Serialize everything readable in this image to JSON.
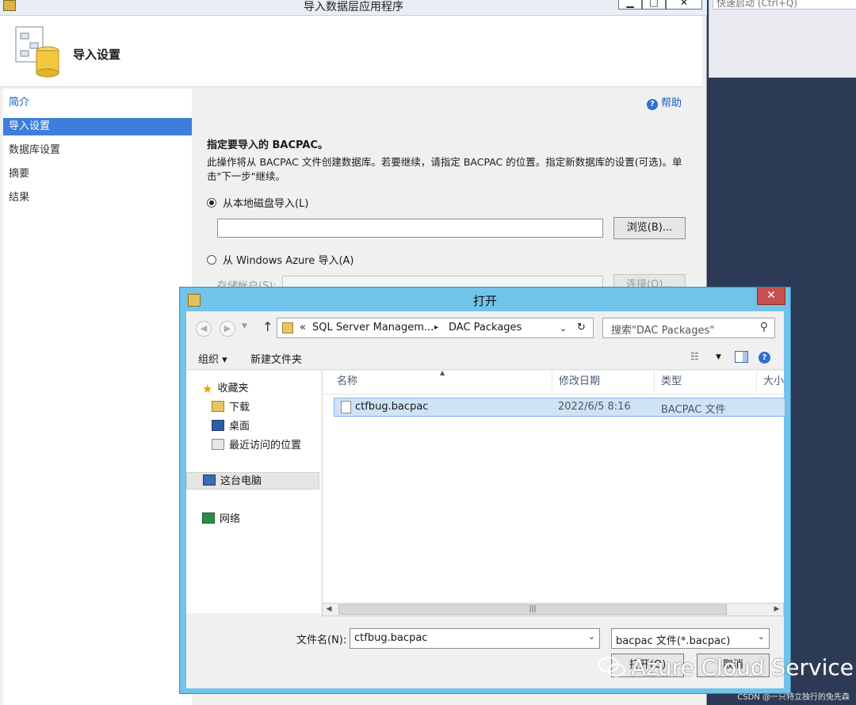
{
  "wizard": {
    "title": "导入数据层应用程序",
    "minimize": "▁",
    "maximize": "□",
    "close": "✕",
    "header_title": "导入设置",
    "nav": [
      "简介",
      "导入设置",
      "数据库设置",
      "摘要",
      "结果"
    ],
    "help": "帮助",
    "section_title": "指定要导入的 BACPAC。",
    "section_desc": "此操作将从 BACPAC 文件创建数据库。若要继续，请指定 BACPAC 的位置。指定新数据库的设置(可选)。单击\"下一步\"继续。",
    "radio_local": "从本地磁盘导入(L)",
    "browse": "浏览(B)...",
    "radio_azure": "从 Windows Azure 导入(A)",
    "storage_account": "存储帐户(S):",
    "connect": "连接(O)..."
  },
  "vs": {
    "quick_launch": "快速启动 (Ctrl+Q)"
  },
  "dialog": {
    "title": "打开",
    "close": "✕",
    "address": {
      "prefix": "«",
      "seg1": "SQL Server Managem...",
      "arrow": "▸",
      "seg2": "DAC Packages"
    },
    "search_placeholder": "搜索\"DAC Packages\"",
    "organize": "组织 ▾",
    "new_folder": "新建文件夹",
    "tree": {
      "favorites": "收藏夹",
      "downloads": "下载",
      "desktop": "桌面",
      "recent": "最近访问的位置",
      "this_pc": "这台电脑",
      "network": "网络"
    },
    "columns": [
      "名称",
      "修改日期",
      "类型",
      "大小"
    ],
    "file": {
      "name": "ctfbug.bacpac",
      "date": "2022/6/5 8:16",
      "type": "BACPAC 文件"
    },
    "filename_label": "文件名(N):",
    "filename_value": "ctfbug.bacpac",
    "filetype_value": "bacpac 文件(*.bacpac)",
    "open": "打开(O)",
    "cancel": "取消"
  },
  "watermark": "Azure Cloud Service",
  "csdn": "CSDN @一只特立独行的兔先森",
  "colors": {
    "accent": "#3d7edb",
    "dialog_frame": "#71c3ea",
    "close_red": "#c75050"
  }
}
